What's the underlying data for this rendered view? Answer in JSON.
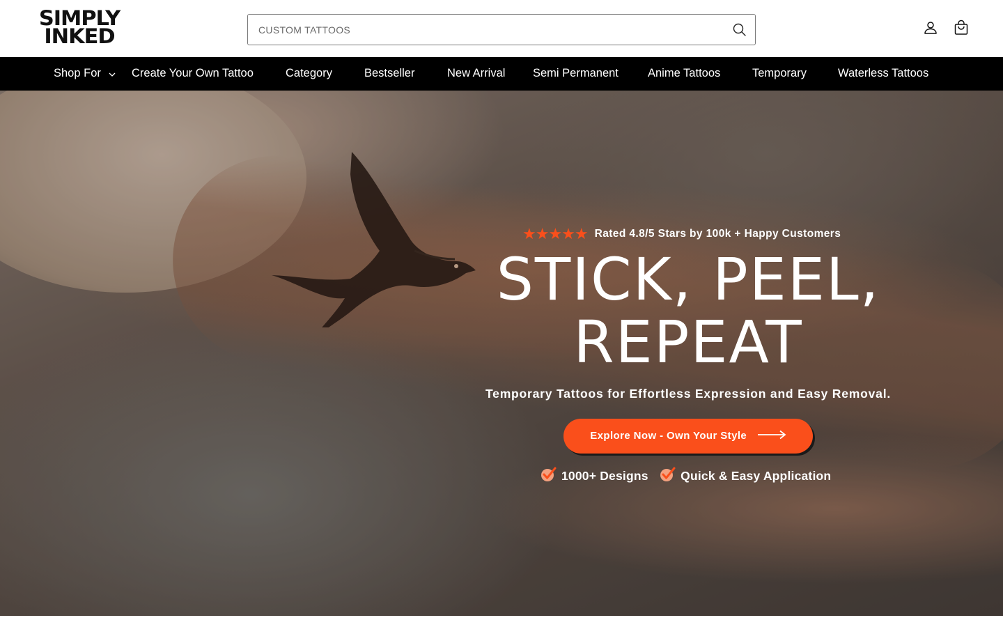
{
  "brand": {
    "logo_line1": "SIMPLY",
    "logo_line2": "INKED"
  },
  "search": {
    "placeholder": "CUSTOM TATTOOS",
    "value": ""
  },
  "header": {
    "account_icon": "user-icon",
    "cart_icon": "shopping-bag-icon"
  },
  "nav": {
    "items": [
      {
        "label": "Shop For",
        "has_dropdown": true
      },
      {
        "label": "Create Your Own Tattoo"
      },
      {
        "label": "Category"
      },
      {
        "label": "Bestseller"
      },
      {
        "label": "New Arrival"
      },
      {
        "label": "Semi Permanent"
      },
      {
        "label": "Anime Tattoos"
      },
      {
        "label": "Temporary"
      },
      {
        "label": "Waterless Tattoos"
      }
    ]
  },
  "hero": {
    "stars": "★★★★★",
    "rating_text": "Rated 4.8/5 Stars by 100k + Happy Customers",
    "headline_line1": "STICK, PEEL,",
    "headline_line2": "REPEAT",
    "subheading": "Temporary Tattoos for Effortless Expression and Easy Removal.",
    "cta_label": "Explore Now - Own Your Style",
    "features": [
      "1000+ Designs",
      "Quick & Easy Application"
    ]
  },
  "colors": {
    "accent": "#fa4f1b",
    "nav_bg": "#000000",
    "header_bg": "#ffffff"
  }
}
